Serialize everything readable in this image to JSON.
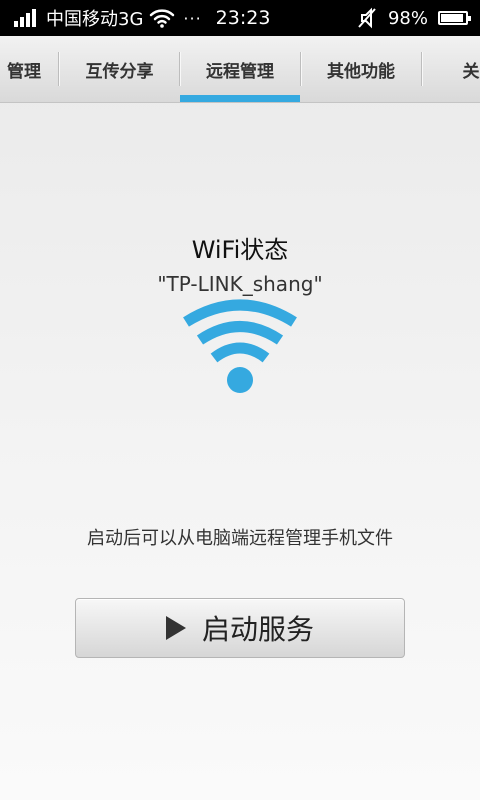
{
  "status_bar": {
    "carrier": "中国移动3G",
    "dots": "···",
    "time": "23:23",
    "battery": "98%",
    "battery_level": 0.98,
    "icons": [
      "signal-icon",
      "wifi-icon",
      "mute-icon",
      "battery-icon"
    ]
  },
  "tabs": [
    {
      "label": "管理",
      "active": false
    },
    {
      "label": "互传分享",
      "active": false
    },
    {
      "label": "远程管理",
      "active": true
    },
    {
      "label": "其他功能",
      "active": false
    },
    {
      "label": "关",
      "active": false
    }
  ],
  "main": {
    "title": "WiFi状态",
    "ssid": "\"TP-LINK_shang\"",
    "hint": "启动后可以从电脑端远程管理手机文件",
    "start_button": "启动服务"
  },
  "colors": {
    "accent": "#35a9e0",
    "status_bar_bg": "#000000"
  }
}
